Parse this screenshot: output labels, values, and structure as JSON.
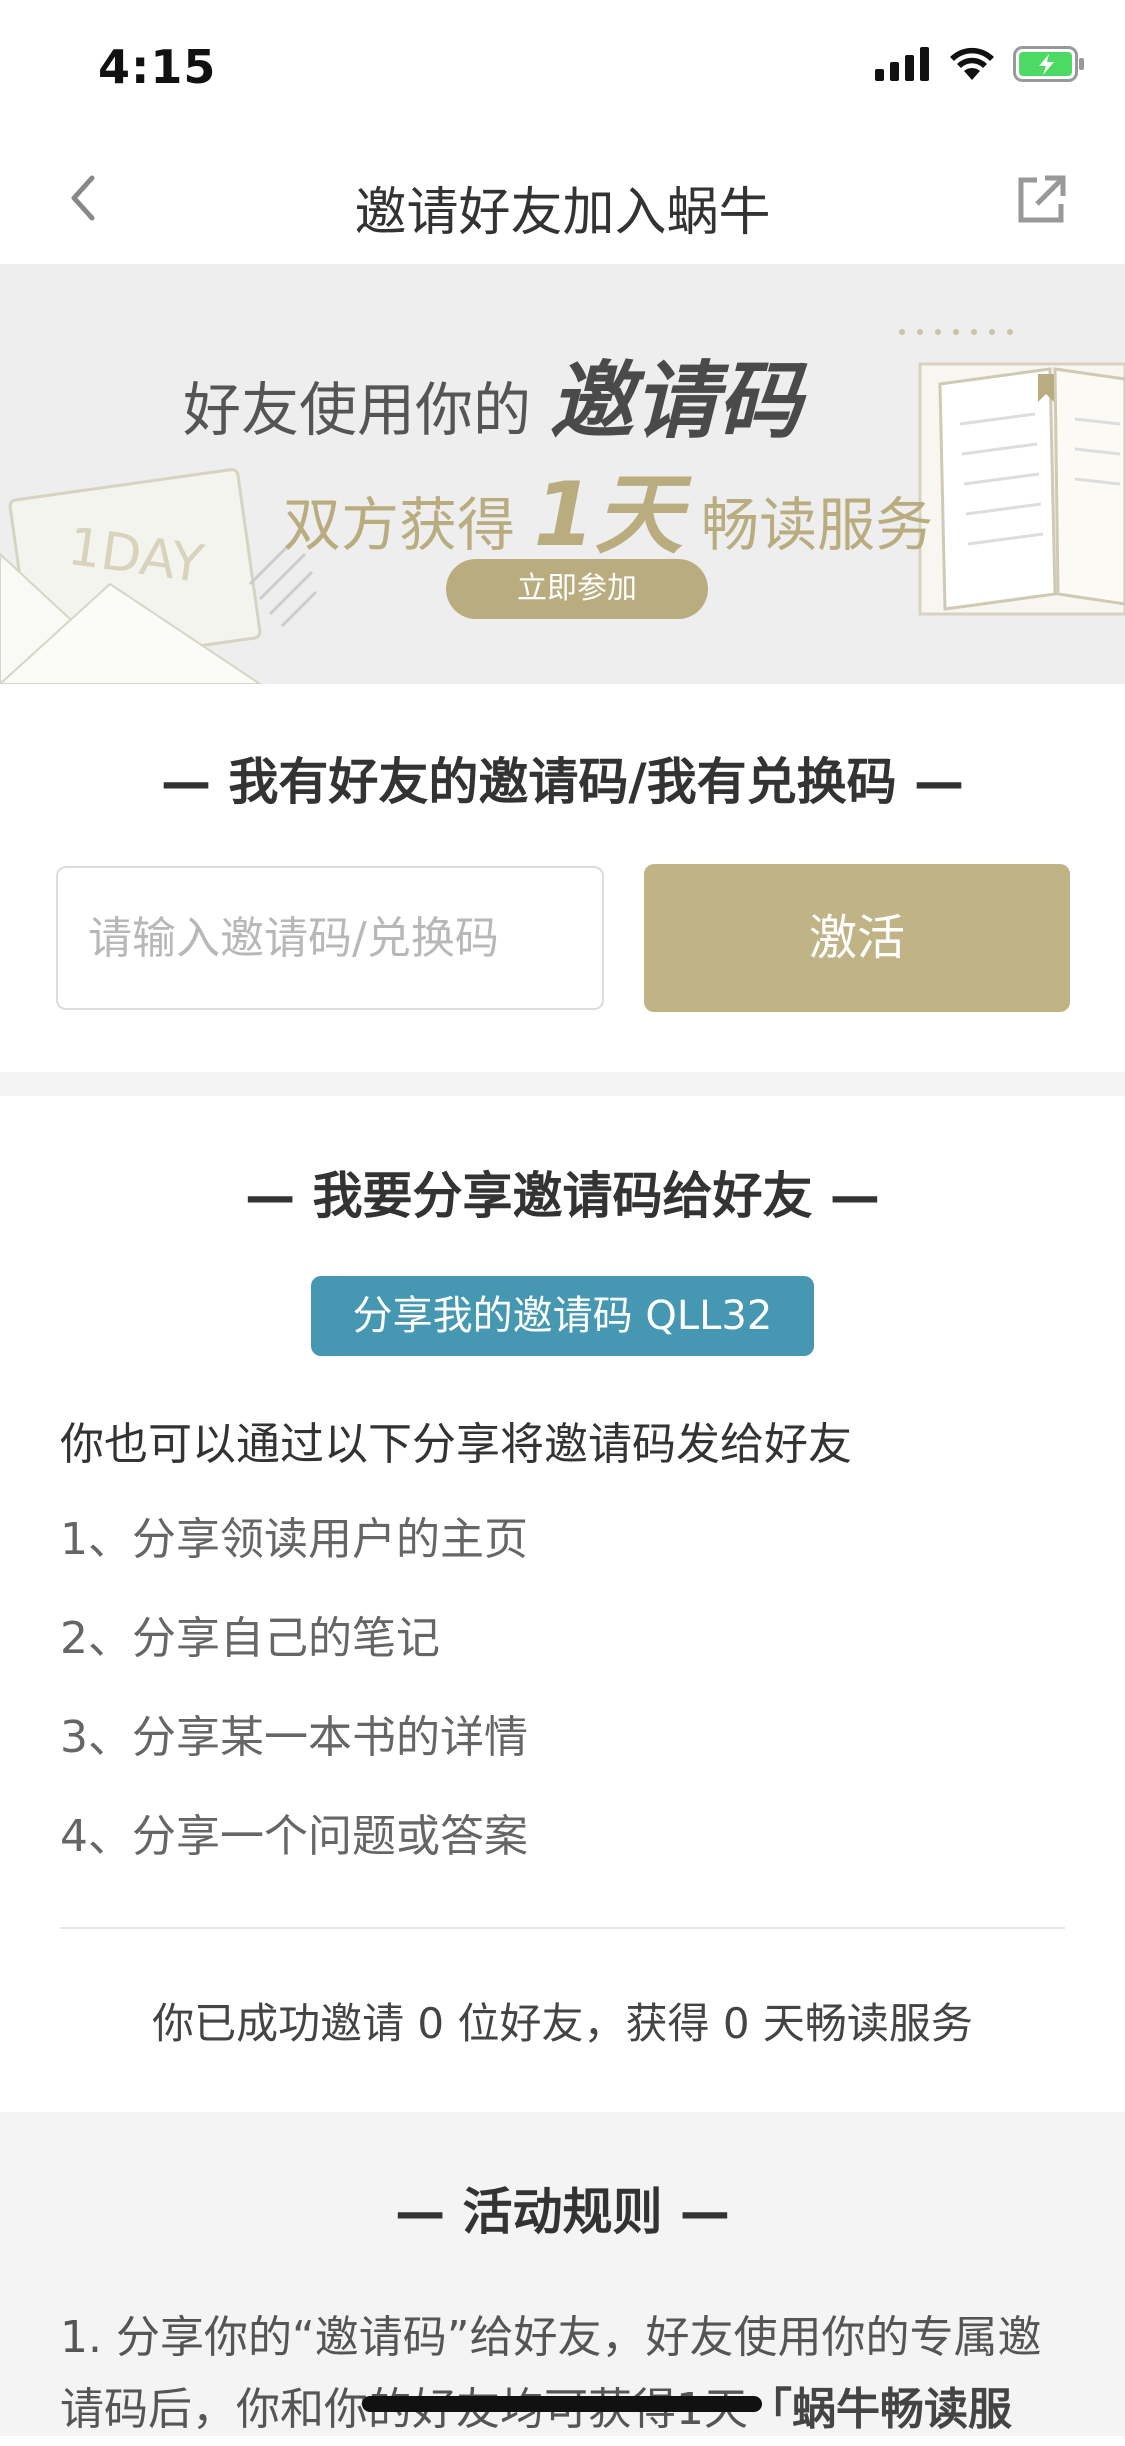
{
  "status_bar": {
    "time": "4:15"
  },
  "nav": {
    "title": "邀请好友加入蜗牛",
    "back_icon": "chevron-left-icon",
    "share_icon": "external-share-icon"
  },
  "banner": {
    "line1_prefix": "好友使用你的",
    "line1_emph": "邀请码",
    "line2_prefix": "双方获得",
    "line2_emph": "1天",
    "line2_suffix": "畅读服务",
    "join_label": "立即参加",
    "ticket_text": "1DAY"
  },
  "redeem": {
    "title": "—  我有好友的邀请码/我有兑换码  —",
    "input_placeholder": "请输入邀请码/兑换码",
    "input_value": "",
    "activate_label": "激活"
  },
  "share": {
    "title": "—  我要分享邀请码给好友  —",
    "share_button_label": "分享我的邀请码 QLL32",
    "intro": "你也可以通过以下分享将邀请码发给好友",
    "items": [
      "1、分享领读用户的主页",
      "2、分享自己的笔记",
      "3、分享某一本书的详情",
      "4、分享一个问题或答案"
    ],
    "summary": "你已成功邀请 0 位好友，获得 0 天畅读服务"
  },
  "rules": {
    "title": "—  活动规则  —",
    "text_prefix": "1. 分享你的“邀请码”给好友，好友使用你的专属邀请码后，你和你的好友均可获得1天",
    "text_bold": "「蜗牛畅读服"
  },
  "colors": {
    "accent_gold": "#c0b487",
    "share_blue": "#4697b2"
  }
}
